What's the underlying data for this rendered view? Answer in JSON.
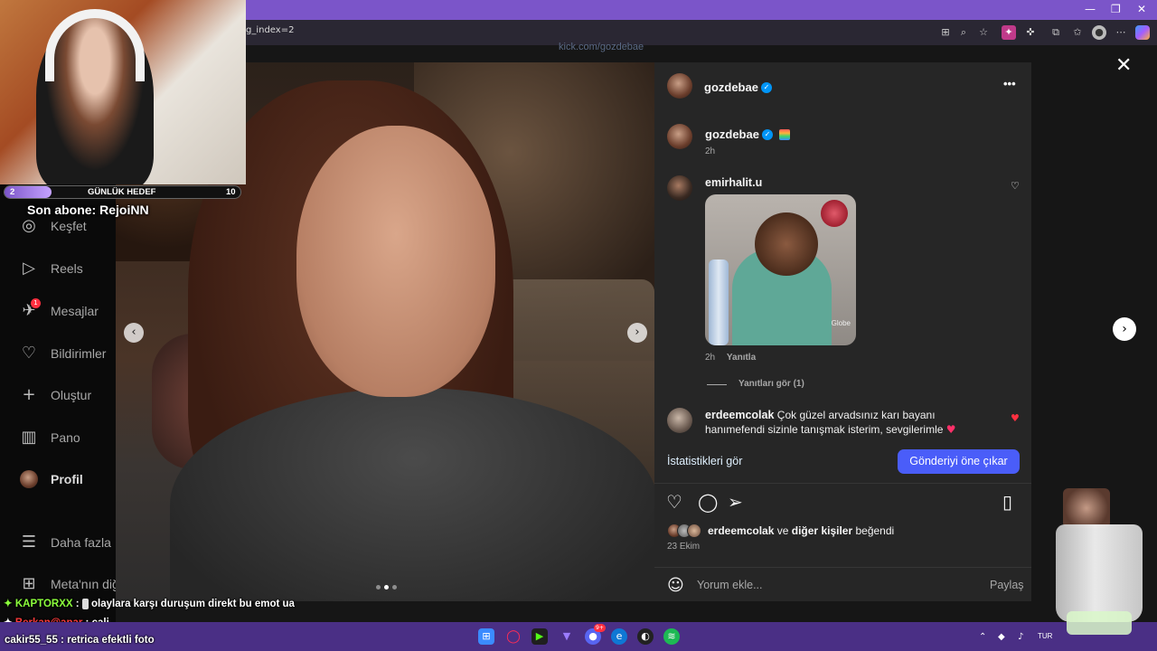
{
  "browser": {
    "url": "g_index=2",
    "win_minimize": "—",
    "win_restore": "❐",
    "win_close": "✕"
  },
  "page": {
    "kick_url": "kick.com/gozdebae"
  },
  "nav": {
    "items": [
      {
        "label": "Keşfet",
        "icon": "compass-icon"
      },
      {
        "label": "Reels",
        "icon": "reels-icon"
      },
      {
        "label": "Mesajlar",
        "icon": "messenger-icon",
        "badge": "1"
      },
      {
        "label": "Bildirimler",
        "icon": "heart-icon"
      },
      {
        "label": "Oluştur",
        "icon": "plus-icon"
      },
      {
        "label": "Pano",
        "icon": "dashboard-icon"
      },
      {
        "label": "Profil",
        "icon": "avatar"
      },
      {
        "label": "Daha fazla",
        "icon": "menu-icon"
      },
      {
        "label": "Meta'nın diğ",
        "icon": "apps-icon"
      }
    ]
  },
  "post": {
    "author": "gozdebae",
    "more": "•••",
    "caption_author": "gozdebae",
    "caption_time": "2h",
    "comments": [
      {
        "user": "emirhalit.u",
        "time": "2h",
        "reply": "Yanıtla",
        "gif_watermark": "Globe"
      },
      {
        "user": "erdeemcolak",
        "text": "Çok güzel arvadsınız karı bayanı hanımefendi sizinle tanışmak isterim, sevgilerimle"
      }
    ],
    "view_replies": "Yanıtları gör (1)",
    "stats_link": "İstatistikleri gör",
    "boost_button": "Gönderiyi öne çıkar",
    "liked_by_user": "erdeemcolak",
    "liked_by_connector": "ve",
    "liked_by_others": "diğer kişiler",
    "liked_by_suffix": "beğendi",
    "date": "23 Ekim",
    "comment_placeholder": "Yorum ekle...",
    "share_label": "Paylaş"
  },
  "stream": {
    "goal_current": "2",
    "goal_label": "GÜNLÜK HEDEF",
    "goal_target": "10",
    "goal_progress": 0.2,
    "last_sub": "Son abone: RejoiNN",
    "chat": [
      {
        "user": "KAPTORXX",
        "sep": ":",
        "text": "olaylara karşı duruşum direkt bu emot ua",
        "color": "#8cff3c"
      },
      {
        "user": "Berkan@apar",
        "sep": ":",
        "text": "çali",
        "color": "#ff3b3b"
      },
      {
        "user": "cakir55_55",
        "sep": ":",
        "text": "retrica efektli foto",
        "color": "#ffffff"
      }
    ]
  },
  "taskbar": {
    "tray_lang": "TUR",
    "notif_badge": "9+"
  }
}
